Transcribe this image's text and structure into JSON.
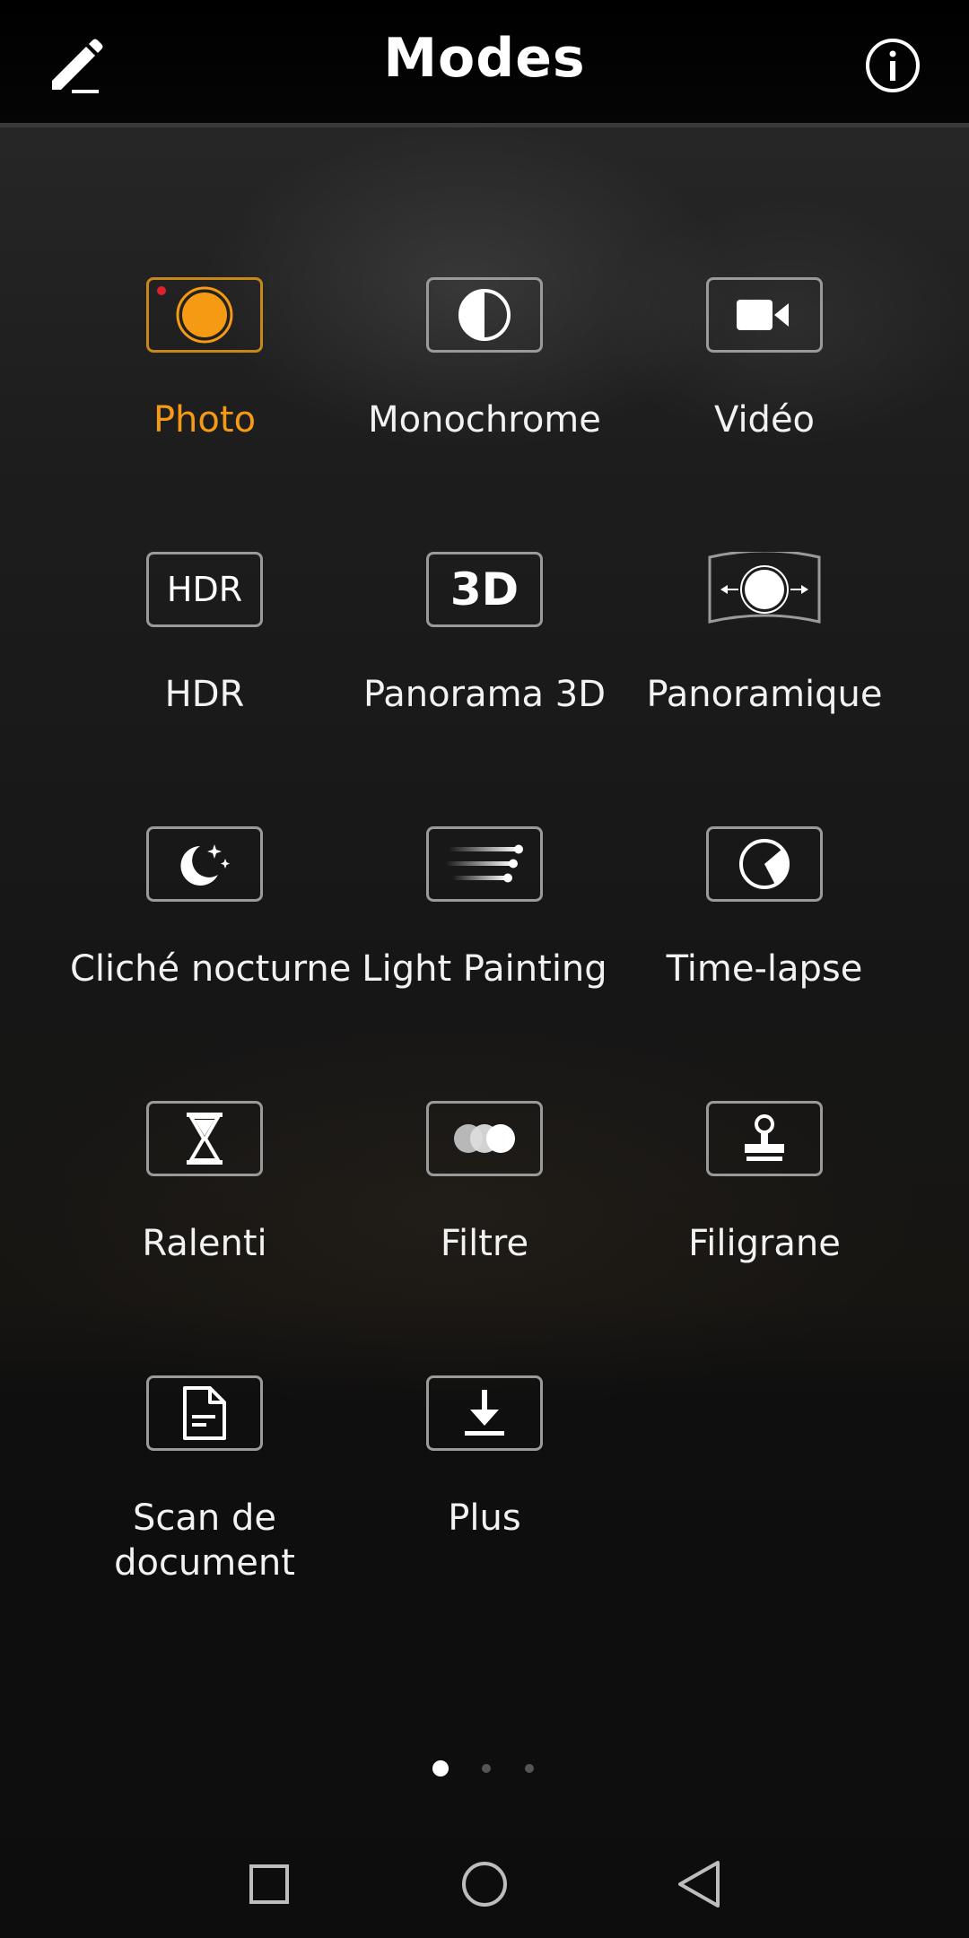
{
  "header": {
    "title": "Modes",
    "edit_icon": "pencil-icon",
    "info_icon": "info-icon"
  },
  "colors": {
    "accent": "#f59a12",
    "box_border": "#9a9a9a",
    "recording_dot": "#e0202a"
  },
  "modes": [
    {
      "label": "Photo",
      "icon": "camera-shutter-icon",
      "active": true
    },
    {
      "label": "Monochrome",
      "icon": "half-circle-icon",
      "active": false
    },
    {
      "label": "Vidéo",
      "icon": "video-camera-icon",
      "active": false
    },
    {
      "label": "HDR",
      "icon": "hdr-icon",
      "icon_text": "HDR",
      "active": false
    },
    {
      "label": "Panorama 3D",
      "icon": "panorama-3d-icon",
      "icon_text": "3D",
      "active": false
    },
    {
      "label": "Panoramique",
      "icon": "panorama-icon",
      "active": false
    },
    {
      "label": "Cliché nocturne",
      "icon": "moon-stars-icon",
      "active": false
    },
    {
      "label": "Light Painting",
      "icon": "light-trails-icon",
      "active": false
    },
    {
      "label": "Time-lapse",
      "icon": "time-lapse-icon",
      "active": false
    },
    {
      "label": "Ralenti",
      "icon": "hourglass-icon",
      "active": false
    },
    {
      "label": "Filtre",
      "icon": "filter-circles-icon",
      "active": false
    },
    {
      "label": "Filigrane",
      "icon": "stamp-icon",
      "active": false
    },
    {
      "label": "Scan de document",
      "icon": "document-icon",
      "active": false
    },
    {
      "label": "Plus",
      "icon": "download-icon",
      "active": false
    }
  ],
  "pagination": {
    "pages": 3,
    "current": 1
  },
  "navbar": {
    "recents_icon": "square-icon",
    "home_icon": "circle-icon",
    "back_icon": "triangle-back-icon"
  }
}
